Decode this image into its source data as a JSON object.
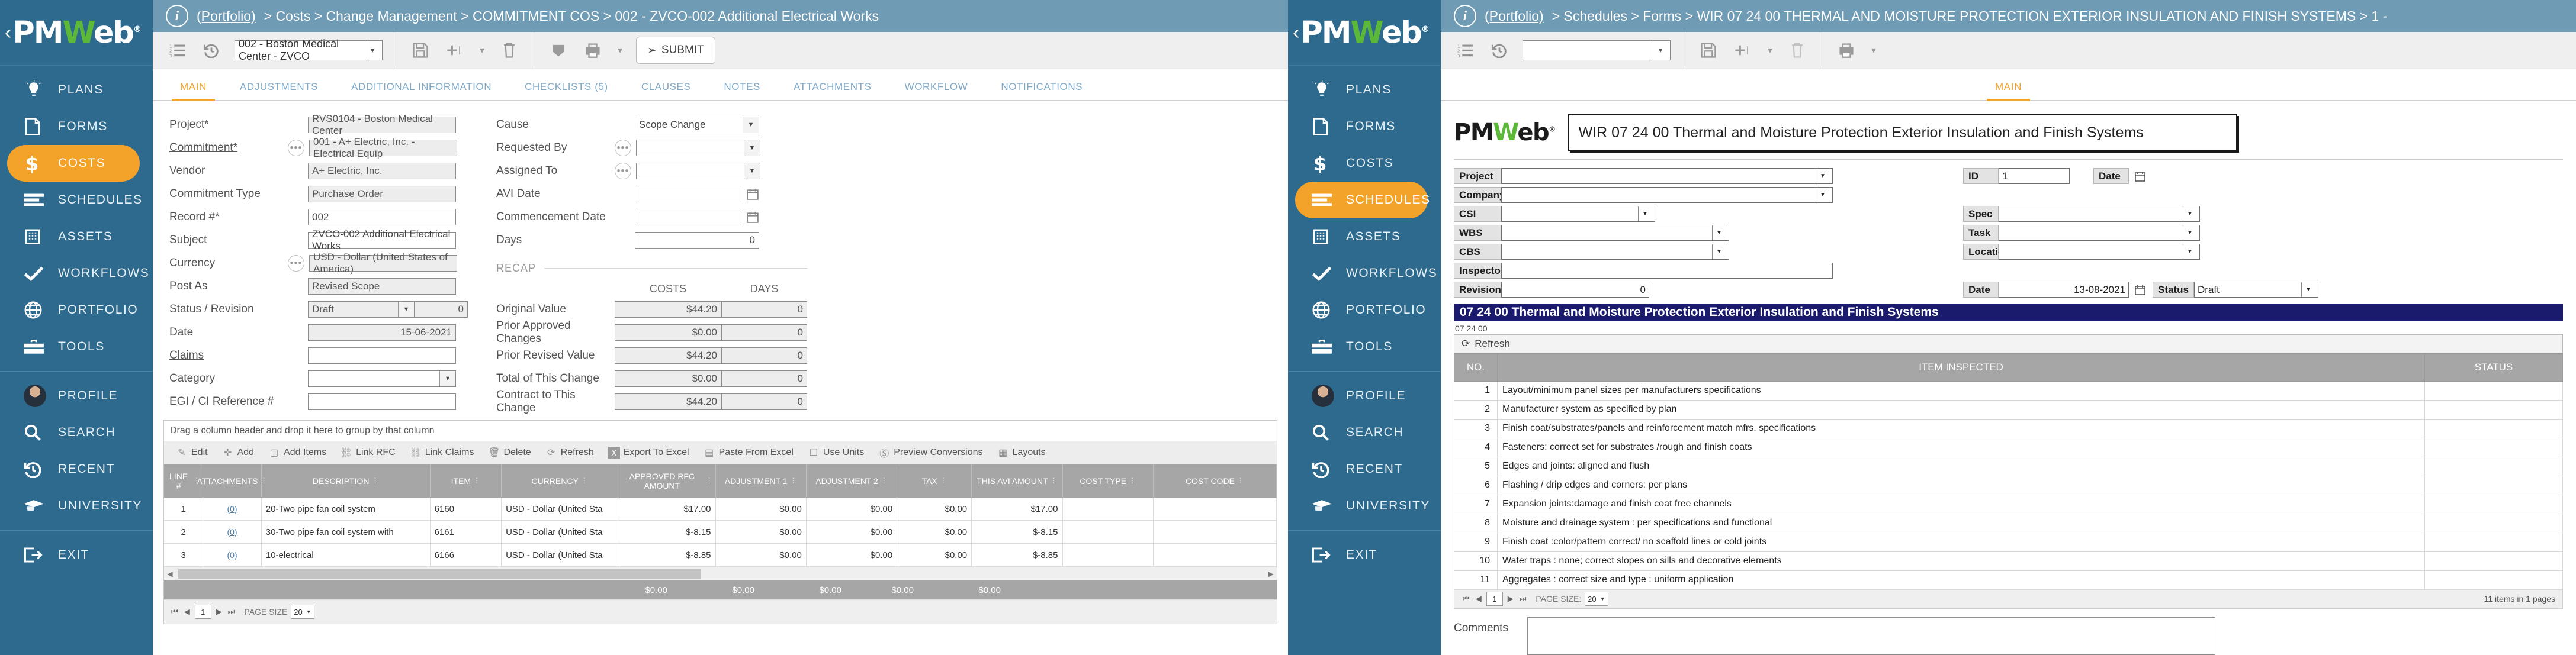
{
  "left": {
    "breadcrumb": {
      "portfolio": "(Portfolio)",
      "rest": "> Costs > Change Management > COMMITMENT COS > 002 - ZVCO-002 Additional Electrical Works"
    },
    "toolbar": {
      "record_select": "002 - Boston Medical Center - ZVCO",
      "submit_label": "SUBMIT"
    },
    "tabs": [
      {
        "label": "MAIN",
        "active": true
      },
      {
        "label": "ADJUSTMENTS",
        "active": false
      },
      {
        "label": "ADDITIONAL INFORMATION",
        "active": false
      },
      {
        "label": "CHECKLISTS (5)",
        "active": false
      },
      {
        "label": "CLAUSES",
        "active": false
      },
      {
        "label": "NOTES",
        "active": false
      },
      {
        "label": "ATTACHMENTS",
        "active": false
      },
      {
        "label": "WORKFLOW",
        "active": false
      },
      {
        "label": "NOTIFICATIONS",
        "active": false
      }
    ],
    "form_left": [
      {
        "label": "Project*",
        "value": "RVS0104 - Boston Medical Center"
      },
      {
        "label": "Commitment*",
        "value": "001 - A+ Electric, Inc. - Electrical Equip"
      },
      {
        "label": "Vendor",
        "value": "A+ Electric, Inc."
      },
      {
        "label": "Commitment Type",
        "value": "Purchase Order"
      },
      {
        "label": "Record #*",
        "value": "002"
      },
      {
        "label": "Subject",
        "value": "ZVCO-002 Additional Electrical Works"
      },
      {
        "label": "Currency",
        "value": "USD - Dollar (United States of America)"
      },
      {
        "label": "Post As",
        "value": "Revised Scope"
      },
      {
        "label": "Status / Revision",
        "value": "Draft",
        "value2": "0"
      },
      {
        "label": "Date",
        "value": "15-06-2021"
      },
      {
        "label": "Claims",
        "value": ""
      },
      {
        "label": "Category",
        "value": ""
      },
      {
        "label": "EGI / CI Reference #",
        "value": ""
      }
    ],
    "form_right": [
      {
        "label": "Cause",
        "value": "Scope Change"
      },
      {
        "label": "Requested By",
        "value": ""
      },
      {
        "label": "Assigned To",
        "value": ""
      },
      {
        "label": "AVI Date",
        "value": ""
      },
      {
        "label": "Commencement Date",
        "value": ""
      },
      {
        "label": "Days",
        "value": "0"
      }
    ],
    "recap": {
      "section_label": "RECAP",
      "col_costs": "COSTS",
      "col_days": "DAYS",
      "rows": [
        {
          "label": "Original Value",
          "cost": "$44.20",
          "days": "0"
        },
        {
          "label": "Prior Approved Changes",
          "cost": "$0.00",
          "days": "0"
        },
        {
          "label": "Prior Revised Value",
          "cost": "$44.20",
          "days": "0"
        },
        {
          "label": "Total of This Change",
          "cost": "$0.00",
          "days": "0"
        },
        {
          "label": "Contract to This Change",
          "cost": "$44.20",
          "days": "0"
        }
      ]
    },
    "grid": {
      "drag_hint": "Drag a column header and drop it here to group by that column",
      "toolbar": [
        {
          "label": "Edit",
          "icon": "pencil-icon"
        },
        {
          "label": "Add",
          "icon": "plus-icon"
        },
        {
          "label": "Add Items",
          "icon": "page-icon"
        },
        {
          "label": "Link RFC",
          "icon": "link-icon"
        },
        {
          "label": "Link Claims",
          "icon": "link-icon"
        },
        {
          "label": "Delete",
          "icon": "trash-icon"
        },
        {
          "label": "Refresh",
          "icon": "refresh-icon"
        },
        {
          "label": "Export To Excel",
          "icon": "excel-icon"
        },
        {
          "label": "Paste From Excel",
          "icon": "clipboard-icon"
        },
        {
          "label": "Use Units",
          "icon": "checkbox-icon"
        },
        {
          "label": "Preview Conversions",
          "icon": "dollar-icon"
        },
        {
          "label": "Layouts",
          "icon": "grid-icon"
        }
      ],
      "columns": [
        "LINE #",
        "ATTACHMENTS",
        "DESCRIPTION",
        "ITEM",
        "CURRENCY",
        "APPROVED RFC AMOUNT",
        "ADJUSTMENT 1",
        "ADJUSTMENT 2",
        "TAX",
        "THIS AVI AMOUNT",
        "COST TYPE",
        "COST CODE"
      ],
      "rows": [
        {
          "line": "1",
          "attach": "(0)",
          "description": "20-Two pipe fan coil system",
          "item": "6160",
          "currency": "USD - Dollar (United Sta",
          "approved": "$17.00",
          "adj1": "$0.00",
          "adj2": "$0.00",
          "tax": "$0.00",
          "this_avi": "$17.00",
          "cost_type": "",
          "cost_code": ""
        },
        {
          "line": "2",
          "attach": "(0)",
          "description": "30-Two pipe fan coil system with",
          "item": "6161",
          "currency": "USD - Dollar (United Sta",
          "approved": "$-8.15",
          "adj1": "$0.00",
          "adj2": "$0.00",
          "tax": "$0.00",
          "this_avi": "$-8.15",
          "cost_type": "",
          "cost_code": ""
        },
        {
          "line": "3",
          "attach": "(0)",
          "description": "10-electrical",
          "item": "6166",
          "currency": "USD - Dollar (United Sta",
          "approved": "$-8.85",
          "adj1": "$0.00",
          "adj2": "$0.00",
          "tax": "$0.00",
          "this_avi": "$-8.85",
          "cost_type": "",
          "cost_code": ""
        }
      ],
      "totals": [
        "$0.00",
        "$0.00",
        "$0.00",
        "$0.00",
        "$0.00"
      ],
      "pager": {
        "page": "1",
        "page_size_label": "PAGE SIZE",
        "page_size": "20"
      }
    }
  },
  "right": {
    "breadcrumb": {
      "portfolio": "(Portfolio)",
      "rest": "> Schedules > Forms > WIR 07 24 00 THERMAL AND MOISTURE PROTECTION EXTERIOR INSULATION AND FINISH SYSTEMS > 1 -"
    },
    "toolbar": {
      "record_select": ""
    },
    "tabs": [
      {
        "label": "MAIN",
        "active": true
      }
    ],
    "report": {
      "title": "WIR 07 24 00 Thermal and Moisture Protection Exterior Insulation and Finish Systems",
      "banner": "07 24 00 Thermal and Moisture Protection Exterior Insulation and Finish Systems",
      "subcode": "07 24 00",
      "refresh_label": "Refresh",
      "fields_col1": [
        {
          "label": "Project",
          "value": "",
          "type": "dropdown"
        },
        {
          "label": "Company",
          "value": "",
          "type": "dropdown"
        },
        {
          "label": "CSI",
          "value": "",
          "type": "dropdown"
        },
        {
          "label": "WBS",
          "value": "",
          "type": "dropdown"
        },
        {
          "label": "CBS",
          "value": "",
          "type": "dropdown"
        },
        {
          "label": "Inspector",
          "value": "",
          "type": "text"
        },
        {
          "label": "Revision",
          "value": "0",
          "type": "number"
        }
      ],
      "fields_col2": [
        {
          "label": "ID",
          "value": "1",
          "type": "text"
        },
        {
          "label": "Date",
          "value": "",
          "type": "date"
        },
        {
          "label": "Spec",
          "value": "",
          "type": "dropdown"
        },
        {
          "label": "Task",
          "value": "",
          "type": "dropdown"
        },
        {
          "label": "Location",
          "value": "",
          "type": "dropdown"
        },
        {
          "label": "Date",
          "value": "13-08-2021",
          "type": "date"
        },
        {
          "label": "Status",
          "value": "Draft",
          "type": "dropdown"
        }
      ],
      "table": {
        "columns": [
          "NO.",
          "ITEM INSPECTED",
          "STATUS"
        ],
        "rows": [
          {
            "no": "1",
            "item": "Layout/minimum panel sizes per manufacturers specifications",
            "status": ""
          },
          {
            "no": "2",
            "item": "Manufacturer system as specified by plan",
            "status": ""
          },
          {
            "no": "3",
            "item": "Finish coat/substrates/panels and reinforcement match mfrs. specifications",
            "status": ""
          },
          {
            "no": "4",
            "item": "Fasteners: correct set for substrates /rough and finish coats",
            "status": ""
          },
          {
            "no": "5",
            "item": "Edges and joints: aligned and flush",
            "status": ""
          },
          {
            "no": "6",
            "item": "Flashing / drip edges and corners: per plans",
            "status": ""
          },
          {
            "no": "7",
            "item": "Expansion joints:damage and finish coat free channels",
            "status": ""
          },
          {
            "no": "8",
            "item": "Moisture and drainage system : per specifications and functional",
            "status": ""
          },
          {
            "no": "9",
            "item": "Finish coat :color/pattern correct/ no scaffold lines or cold joints",
            "status": ""
          },
          {
            "no": "10",
            "item": "Water traps : none; correct slopes on sills and decorative elements",
            "status": ""
          },
          {
            "no": "11",
            "item": "Aggregates : correct size and type : uniform application",
            "status": ""
          }
        ],
        "pager": {
          "page": "1",
          "page_size_label": "PAGE SIZE:",
          "page_size": "20",
          "items_text": "11 items in 1 pages"
        }
      },
      "comments_label": "Comments"
    }
  },
  "sidebar_items": [
    {
      "label": "PLANS",
      "icon": "lightbulb-icon",
      "active": false
    },
    {
      "label": "FORMS",
      "icon": "form-icon",
      "active": false
    },
    {
      "label": "COSTS",
      "icon": "dollar-icon",
      "active": false
    },
    {
      "label": "SCHEDULES",
      "icon": "schedule-icon",
      "active": false
    },
    {
      "label": "ASSETS",
      "icon": "building-icon",
      "active": false
    },
    {
      "label": "WORKFLOWS",
      "icon": "check-icon",
      "active": false
    },
    {
      "label": "PORTFOLIO",
      "icon": "globe-icon",
      "active": false
    },
    {
      "label": "TOOLS",
      "icon": "toolbox-icon",
      "active": false
    },
    {
      "label": "PROFILE",
      "icon": "avatar-icon",
      "active": false
    },
    {
      "label": "SEARCH",
      "icon": "search-icon",
      "active": false
    },
    {
      "label": "RECENT",
      "icon": "history-icon",
      "active": false
    },
    {
      "label": "UNIVERSITY",
      "icon": "graduation-icon",
      "active": false
    },
    {
      "label": "EXIT",
      "icon": "exit-icon",
      "active": false
    }
  ],
  "logo": {
    "pm": "PM",
    "w": "W",
    "eb": "eb",
    "reg": "®"
  },
  "colors": {
    "brand_blue": "#2e6a8e",
    "accent_orange": "#f4a32a",
    "green": "#5cb838",
    "banner_navy": "#1b1b6e"
  }
}
